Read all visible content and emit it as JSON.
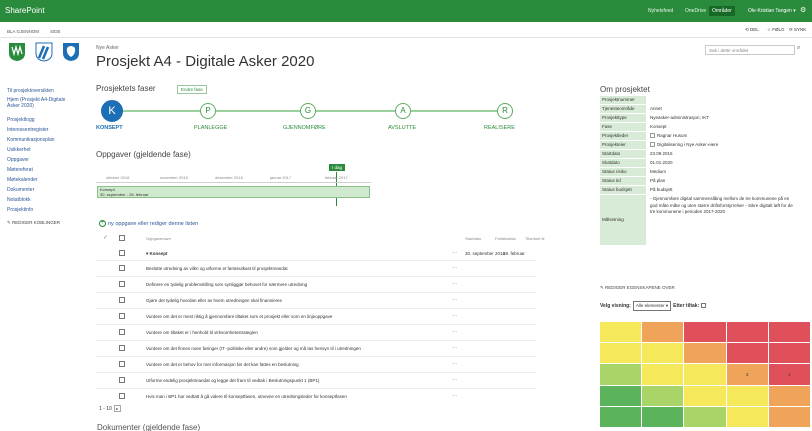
{
  "suitebar": {
    "title": "SharePoint",
    "links": [
      "Nyhetsfeed",
      "OneDrive",
      "Områder"
    ],
    "active_link": "Områder",
    "user": "Ole-Kristian Tangen ▾",
    "colors": {
      "bar": "#2a8b3c"
    }
  },
  "ribbon": {
    "browse": "BLA GJENNOM",
    "page": "SIDE",
    "share": "DEL",
    "follow": "FØLG",
    "sync": "SYNK"
  },
  "header": {
    "site_name": "Nye Asker",
    "page_title": "Prosjekt A4 - Digitale Asker 2020",
    "search_placeholder": "Søk i dette området"
  },
  "nav": {
    "items": [
      "Til prosjektoversikten",
      "Hjem (Prosjekt A4-Digitale Asker 2020)",
      "Prosjektlogg",
      "Interessentregister",
      "Kommunikasjonsplan",
      "Usikkerhet",
      "Oppgaver",
      "Møtereferat",
      "Møtekalender",
      "Dokumenter",
      "Notatblokk",
      "Prosjektinfo"
    ],
    "edit_links": "REDIGER KOBLINGER"
  },
  "phases": {
    "title": "Prosjektets faser",
    "change_button": "Endre fase",
    "items": [
      {
        "letter": "K",
        "label": "KONSEPT",
        "active": true
      },
      {
        "letter": "P",
        "label": "PLANLEGGE",
        "active": false
      },
      {
        "letter": "G",
        "label": "GJENNOMFØRE",
        "active": false
      },
      {
        "letter": "A",
        "label": "AVSLUTTE",
        "active": false
      },
      {
        "letter": "R",
        "label": "REALISERE",
        "active": false
      }
    ]
  },
  "tasks": {
    "title": "Oppgaver (gjeldende fase)",
    "timeline": {
      "today_label": "I dag",
      "months": [
        "oktober 2016",
        "november 2016",
        "desember 2016",
        "januar 2017",
        "februar 2017"
      ],
      "bar_title": "Konsept",
      "bar_dates": "30. september - 28. februar"
    },
    "new_task_link": "ny oppgave eller rediger denne listen",
    "columns": {
      "name": "Oppgavenavn",
      "start": "Startdato",
      "due": "Forfallsdato",
      "assigned": "Tilordnet til"
    },
    "group": {
      "title": "Konsept",
      "start": "30. september 2016",
      "due": "28. februar"
    },
    "rows": [
      "Beslutte utredning av vilkn og utforme et førsteutkast til prosjektmandat",
      "Definere en tydelig problemstilling som synliggjør behovet for nærmere utredning",
      "Gjøre det tydelig hvordan eller av hvem utredningen skal finansieres",
      "Vurdere om det er mest riktig å gjennomføre tiltaket som et prosjekt eller som en linjeoppgave",
      "Vurdere om tiltaket er i henhold til virksomhetsstrategien",
      "Vurdere om det finnes noen føringer (IT -politiske eller andre) som gjelder og må tas hensyn til i utredningen",
      "Vurdere om det er behov for mer informasjon før det kan fattes en beslutning",
      "Utforme endelig prosjektmandat og legge det fram til vedtak i Beslutningspunkt 1 (BP1)",
      "Hvis man i BP1 har vedtatt å gå videre til konseptfasen, utnevne en utredningsleder for konseptfasen"
    ],
    "pager": "1 - 10"
  },
  "documents_title": "Dokumenter (gjeldende fase)",
  "project": {
    "title": "Om prosjektet",
    "rows": [
      {
        "label": "Prosjektnummer",
        "value": ""
      },
      {
        "label": "Tjenesteområde",
        "value": "Annet"
      },
      {
        "label": "Prosjekttype",
        "value": "Nyeasker-administrasjon; IKT"
      },
      {
        "label": "Fase",
        "value": "Konsept"
      },
      {
        "label": "Prosjektleder",
        "value": "Ragnar Husum"
      },
      {
        "label": "Prosjekteier",
        "value": "Digitalisering i Nye Asker-eiere"
      },
      {
        "label": "Startdato",
        "value": "23.09.2016"
      },
      {
        "label": "Sluttdato",
        "value": "01.01.2020"
      },
      {
        "label": "Status risiko",
        "value": "Medium"
      },
      {
        "label": "Status tid",
        "value": "På plan"
      },
      {
        "label": "Status budsjett",
        "value": "På budsjett"
      }
    ],
    "goal_label": "Målsetning",
    "goal_value": "- Gjennomføre digital sammenslåing mellom de tre kommunene på en god måte måte og uten større driftsforstyrrelser - Sikre digitalt løft for de tre kommunene i perioden 2017-2020",
    "edit_properties": "REDIGER EGENSKAPENE OVER",
    "filter_label": "Velg visning:",
    "filter_value": "Alle elementer",
    "measures_label": "Etter tiltak:"
  },
  "heatmap": {
    "colors": {
      "red": "#e0505a",
      "orange": "#f0a45a",
      "yellow": "#f5e85a",
      "lightgreen": "#a8d468",
      "green": "#5bb35c"
    },
    "cells": [
      [
        "yellow",
        "orange",
        "red",
        "red",
        "red"
      ],
      [
        "yellow",
        "yellow",
        "orange",
        "red",
        "red"
      ],
      [
        "lightgreen",
        "yellow",
        "yellow",
        "orange",
        "red"
      ],
      [
        "green",
        "lightgreen",
        "yellow",
        "yellow",
        "orange"
      ],
      [
        "green",
        "green",
        "lightgreen",
        "yellow",
        "orange"
      ]
    ],
    "labels": {
      "2-3": "2",
      "2-4": "1"
    }
  }
}
